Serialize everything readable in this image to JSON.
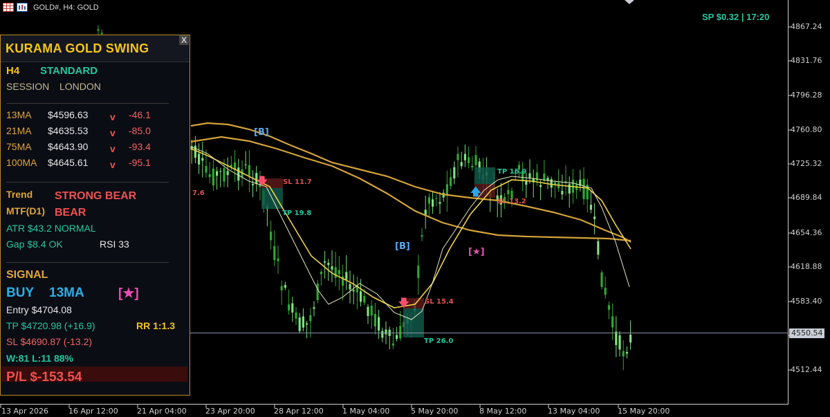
{
  "window": {
    "symbol_label": "GOLD#, H4:  GOLD"
  },
  "status": {
    "spread_time": "SP $0.32  |  17:20"
  },
  "price_axis": {
    "labels": [
      "4867.24",
      "4831.76",
      "4796.28",
      "4760.80",
      "4725.32",
      "4689.84",
      "4654.36",
      "4618.88",
      "4583.40",
      "4550.54",
      "4512.44"
    ],
    "current_price": "4550.54"
  },
  "date_axis": {
    "labels": [
      "13 Apr 2026",
      "16 Apr 12:00",
      "21 Apr 04:00",
      "23 Apr 20:00",
      "28 Apr 12:00",
      "1 May 04:00",
      "5 May 20:00",
      "8 May 12:00",
      "13 May 04:00",
      "15 May 20:00"
    ]
  },
  "chart": {
    "annotations": {
      "b1": "[B]",
      "b2": "[B]",
      "star": "[★]",
      "sl1": "SL 11.7",
      "tp1": "TP 19.8",
      "sl2": "SL 15.4",
      "tp2": "TP 26.0",
      "tp3": "TP 16.9",
      "sl3": "SL 13.2",
      "left_cut": "7.6",
      "arrow_down": "🡇",
      "arrow_up": "🡅"
    },
    "colors": {
      "bull_candle": "#7ee07e",
      "bear_candle": "#2fa82f",
      "ma_fast": "#f2d44a",
      "ma_slow": "#d4a43a",
      "ma_thin": "#e8e8c0"
    }
  },
  "panel": {
    "title": "KURAMA GOLD SWING",
    "close": "X",
    "timeframe": "H4",
    "mode": "STANDARD",
    "session_label": "SESSION",
    "session_value": "LONDON",
    "mas": [
      {
        "name": "13MA",
        "value": "$4596.63",
        "dir": "v",
        "diff": "-46.1"
      },
      {
        "name": "21MA",
        "value": "$4635.53",
        "dir": "v",
        "diff": "-85.0"
      },
      {
        "name": "75MA",
        "value": "$4643.90",
        "dir": "v",
        "diff": "-93.4"
      },
      {
        "name": "100MA",
        "value": "$4645.61",
        "dir": "v",
        "diff": "-95.1"
      }
    ],
    "trend_label": "Trend",
    "trend_value": "STRONG BEAR",
    "mtf_label": "MTF(D1)",
    "mtf_value": "BEAR",
    "atr": "ATR  $43.2  NORMAL",
    "gap": "Gap $8.4 OK",
    "rsi": "RSI 33",
    "signal_label": "SIGNAL",
    "signal_side": "BUY",
    "signal_ma": "13MA",
    "signal_star": "[★]",
    "entry": "Entry  $4704.08",
    "tp": "TP  $4720.98  (+16.9)",
    "rr": "RR 1:1.3",
    "sl": "SL  $4690.87  (-13.2)",
    "winloss": "W:81 L:11  88%",
    "pl": "P/L  $-153.54"
  }
}
